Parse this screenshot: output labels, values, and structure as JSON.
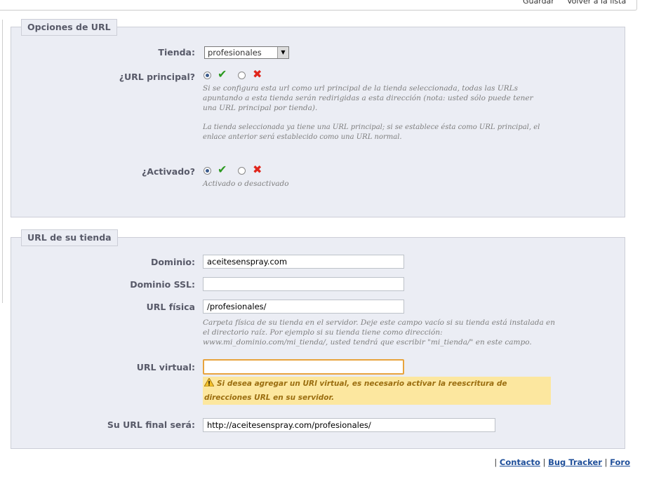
{
  "toolbar": {
    "save_label": "Guardar",
    "back_label": "Volver a la lista"
  },
  "url_options": {
    "legend": "Opciones de URL",
    "shop_label": "Tienda:",
    "shop_value": "profesionales",
    "main_url_label": "¿URL principal?",
    "main_url_value": "yes",
    "main_url_help": "Si se configura esta url como url principal de la tienda seleccionada, todas las URLs apuntando a esta tienda serán redirigidas a esta dirección (nota: usted sólo puede tener una URL principal por tienda).",
    "main_url_note": "La tienda seleccionada ya tiene una URL principal; si se establece ésta como URL principal, el enlace anterior será establecido como una URL normal.",
    "active_label": "¿Activado?",
    "active_value": "yes",
    "active_help": "Activado o desactivado"
  },
  "shop_url": {
    "legend": "URL de su tienda",
    "domain_label": "Dominio:",
    "domain_value": "aceitesenspray.com",
    "domain_ssl_label": "Dominio SSL:",
    "domain_ssl_value": "",
    "physical_label": "URL física",
    "physical_value": "/profesionales/",
    "physical_help": "Carpeta física de su tienda en el servidor. Deje este campo vacío si su tienda está instalada en el directorio raíz. Por ejemplo si su tienda tiene como dirección: www.mi_dominio.com/mi_tienda/, usted tendrá que escribir \"mi_tienda/\" en este campo.",
    "virtual_label": "URL virtual:",
    "virtual_value": "",
    "warning": "Si desea agregar un URl virtual, es necesario activar la reescritura de direcciones URL en su servidor.",
    "final_label": "Su URL final será:",
    "final_value": "http://aceitesenspray.com/profesionales/"
  },
  "footer": {
    "sep": "|",
    "contact": "Contacto",
    "bug_tracker": "Bug Tracker",
    "forum": "Foro"
  },
  "colors": {
    "panel_bg": "#ebedf4",
    "label": "#585a69",
    "warning_bg": "#fce79f",
    "focus_border": "#e8a33d"
  }
}
